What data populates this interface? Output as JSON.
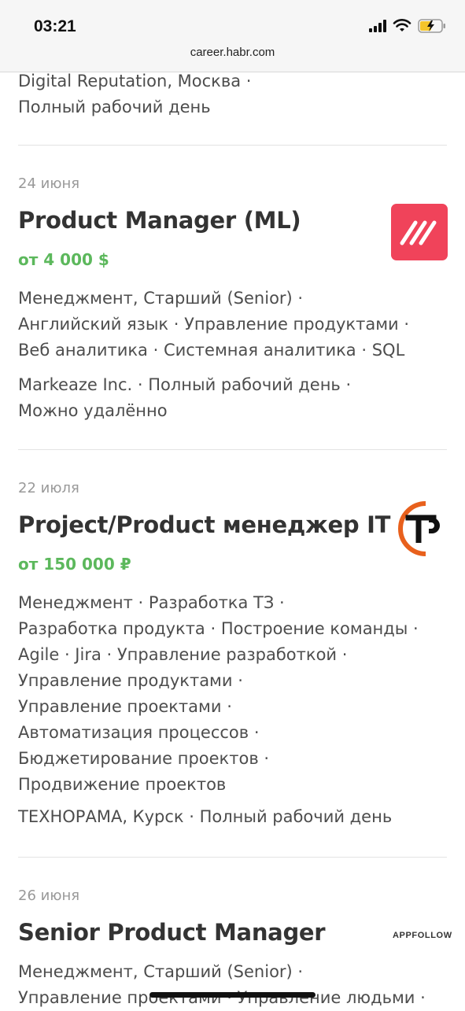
{
  "status_bar": {
    "time": "03:21",
    "url": "career.habr.com"
  },
  "prev_item": {
    "line1": "Digital Reputation, Москва ·",
    "line2": "Полный рабочий день"
  },
  "vacancies": [
    {
      "date": "24 июня",
      "title": "Product Manager (ML)",
      "salary": "от 4 000 $",
      "skills": [
        "Менеджмент, Старший (Senior) ·",
        "Английский язык · Управление продуктами ·",
        "Веб аналитика · Системная аналитика · SQL"
      ],
      "company": [
        "Markeaze Inc. · Полный рабочий день ·",
        "Можно удалённо"
      ],
      "logo_color": "#f0435a"
    },
    {
      "date": "22 июля",
      "title": "Project/Product менеджер IT",
      "salary": "от 150 000 ₽",
      "skills": [
        "Менеджмент · Разработка ТЗ ·",
        "Разработка продукта · Построение команды ·",
        "Agile · Jira · Управление разработкой ·",
        "Управление продуктами ·",
        "Управление проектами ·",
        "Автоматизация процессов ·",
        "Бюджетирование проектов ·",
        "Продвижение проектов"
      ],
      "company": [
        "ТЕХНОРАМА, Курск · Полный рабочий день"
      ],
      "logo_color": "#e8601c"
    },
    {
      "date": "26 июня",
      "title": "Senior Product Manager",
      "skills": [
        "Менеджмент, Старший (Senior) ·",
        "Управление проектами · Управление людьми ·"
      ],
      "logo_text": "APPFOLLOW"
    }
  ]
}
